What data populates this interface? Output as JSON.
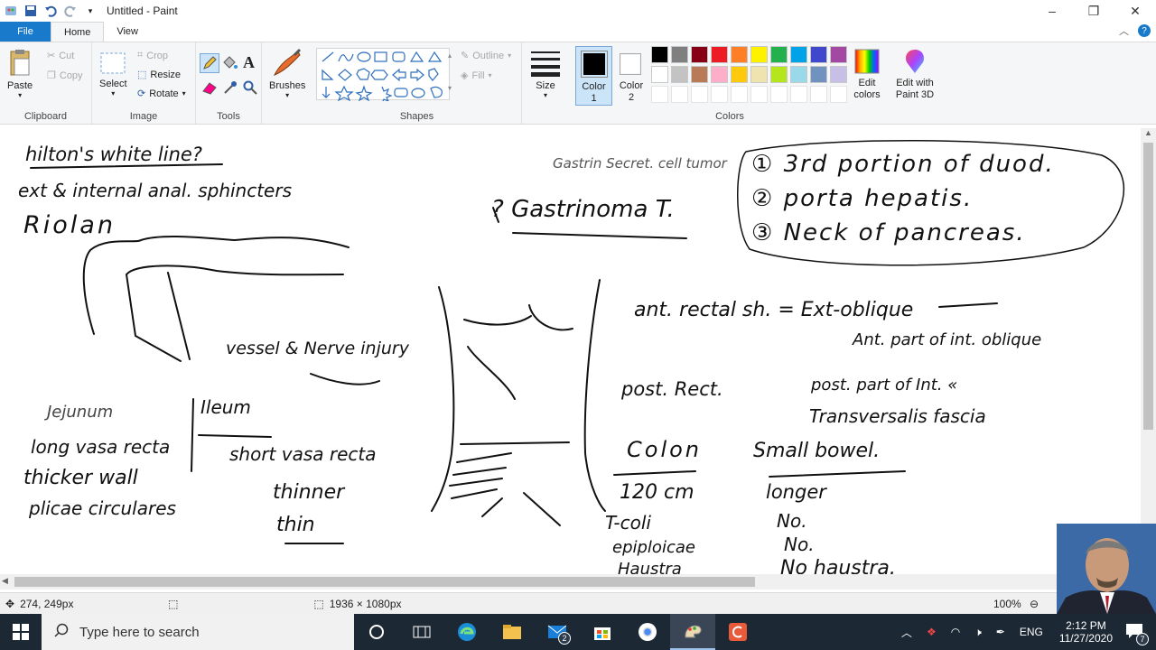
{
  "window": {
    "title": "Untitled - Paint",
    "controls": [
      "minimize",
      "restore",
      "close"
    ]
  },
  "menu": {
    "file": "File",
    "tabs": [
      "Home",
      "View"
    ]
  },
  "ribbon": {
    "clipboard": {
      "group": "Clipboard",
      "paste": "Paste",
      "cut": "Cut",
      "copy": "Copy"
    },
    "image": {
      "group": "Image",
      "select": "Select",
      "crop": "Crop",
      "resize": "Resize",
      "rotate": "Rotate"
    },
    "tools": {
      "group": "Tools"
    },
    "brushes": {
      "label": "Brushes"
    },
    "shapes": {
      "group": "Shapes",
      "outline": "Outline",
      "fill": "Fill"
    },
    "size": {
      "label": "Size"
    },
    "color1": {
      "label": "Color",
      "num": "1",
      "value": "#000000"
    },
    "color2": {
      "label": "Color",
      "num": "2",
      "value": "#ffffff"
    },
    "colors": {
      "group": "Colors",
      "row1": [
        "#000000",
        "#7f7f7f",
        "#880015",
        "#ed1c24",
        "#ff7f27",
        "#fff200",
        "#22b14c",
        "#00a2e8",
        "#3f48cc",
        "#a349a4"
      ],
      "row2": [
        "#ffffff",
        "#c3c3c3",
        "#b97a57",
        "#ffaec9",
        "#ffc90e",
        "#efe4b0",
        "#b5e61d",
        "#99d9ea",
        "#7092be",
        "#c8bfe7"
      ]
    },
    "edit_colors": {
      "line1": "Edit",
      "line2": "colors"
    },
    "paint3d": {
      "line1": "Edit with",
      "line2": "Paint 3D"
    }
  },
  "canvas_notes": {
    "n01": "hilton's white line?",
    "n02": "ext & internal anal. sphincters",
    "n03": "Riolan",
    "n04": "Gastrin Secret. cell tumor",
    "n05": "? Gastrinoma T.",
    "n06": "① 3rd portion of duod.",
    "n07": "② porta hepatis.",
    "n08": "③ Neck of pancreas.",
    "n09": "ant. rectal sh. = Ext-oblique",
    "n10": "Ant. part of int. oblique",
    "n11": "vessel & Nerve injury",
    "n12": "post. Rect.",
    "n13": "post. part of Int. «",
    "n14": "Transversalis fascia",
    "n15": "Jejunum",
    "n16": "Ileum",
    "n17": "long vasa recta",
    "n18": "thicker wall",
    "n19": "plicae circulares",
    "n20": "short vasa recta",
    "n21": "thinner",
    "n22": "thin",
    "n23": "Colon",
    "n24": "Small bowel.",
    "n25": "120 cm",
    "n26": "T-coli",
    "n27": "epiploicae",
    "n28": "Haustra",
    "n29": "longer",
    "n30": "No.",
    "n31": "No.",
    "n32": "No haustra."
  },
  "status": {
    "cursor": "274, 249px",
    "dimensions": "1936 × 1080px",
    "zoom": "100%"
  },
  "taskbar": {
    "search_placeholder": "Type here to search",
    "time": "2:12 PM",
    "date": "11/27/2020",
    "lang": "ENG",
    "mail_badge": "2",
    "notif_badge": "7"
  }
}
